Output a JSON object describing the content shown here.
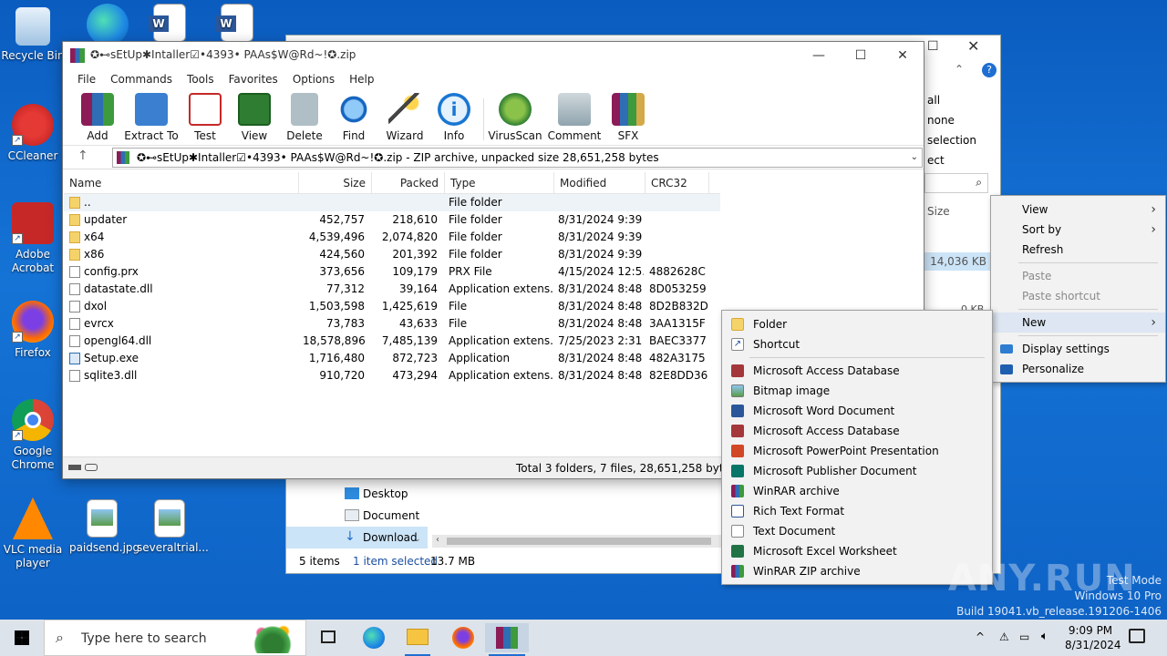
{
  "desktop": {
    "icons": [
      {
        "label": "Recycle Bin"
      },
      {
        "label": "CCleaner"
      },
      {
        "label": "Adobe Acrobat"
      },
      {
        "label": "Firefox"
      },
      {
        "label": "Google Chrome"
      },
      {
        "label": "VLC media player"
      },
      {
        "label": "paidsend.jpg"
      },
      {
        "label": "severaltrial..."
      }
    ]
  },
  "explorer": {
    "partial_text": [
      "all",
      "none",
      "selection",
      "ect"
    ],
    "size_col": "Size",
    "size_value": "14,036 KB",
    "kb_partial": "0 KB",
    "nav": [
      "Desktop",
      "Document",
      "Download"
    ],
    "status_items": "5 items",
    "status_selected": "1 item selected",
    "status_size": "13.7 MB"
  },
  "winrar": {
    "title": "✪⊷sEtUp✱Intaller☑•4393• PAAs$W@Rd~!✪.zip",
    "menu": [
      "File",
      "Commands",
      "Tools",
      "Favorites",
      "Options",
      "Help"
    ],
    "tools": [
      "Add",
      "Extract To",
      "Test",
      "View",
      "Delete",
      "Find",
      "Wizard",
      "Info",
      "VirusScan",
      "Comment",
      "SFX"
    ],
    "address": "✪⊷sEtUp✱Intaller☑•4393• PAAs$W@Rd~!✪.zip - ZIP archive, unpacked size 28,651,258 bytes",
    "columns": [
      "Name",
      "Size",
      "Packed",
      "Type",
      "Modified",
      "CRC32"
    ],
    "rows": [
      {
        "name": "..",
        "size": "",
        "packed": "",
        "type": "File folder",
        "modified": "",
        "crc": "",
        "kind": "folder"
      },
      {
        "name": "updater",
        "size": "452,757",
        "packed": "218,610",
        "type": "File folder",
        "modified": "8/31/2024 9:39 ...",
        "crc": "",
        "kind": "folder"
      },
      {
        "name": "x64",
        "size": "4,539,496",
        "packed": "2,074,820",
        "type": "File folder",
        "modified": "8/31/2024 9:39 ...",
        "crc": "",
        "kind": "folder"
      },
      {
        "name": "x86",
        "size": "424,560",
        "packed": "201,392",
        "type": "File folder",
        "modified": "8/31/2024 9:39 ...",
        "crc": "",
        "kind": "folder"
      },
      {
        "name": "config.prx",
        "size": "373,656",
        "packed": "109,179",
        "type": "PRX File",
        "modified": "4/15/2024 12:5...",
        "crc": "4882628C",
        "kind": "file"
      },
      {
        "name": "datastate.dll",
        "size": "77,312",
        "packed": "39,164",
        "type": "Application extens...",
        "modified": "8/31/2024 8:48 ...",
        "crc": "8D053259",
        "kind": "file"
      },
      {
        "name": "dxol",
        "size": "1,503,598",
        "packed": "1,425,619",
        "type": "File",
        "modified": "8/31/2024 8:48 ...",
        "crc": "8D2B832D",
        "kind": "file"
      },
      {
        "name": "evrcx",
        "size": "73,783",
        "packed": "43,633",
        "type": "File",
        "modified": "8/31/2024 8:48 ...",
        "crc": "3AA1315F",
        "kind": "file"
      },
      {
        "name": "opengl64.dll",
        "size": "18,578,896",
        "packed": "7,485,139",
        "type": "Application extens...",
        "modified": "7/25/2023 2:31 ...",
        "crc": "BAEC3377",
        "kind": "file"
      },
      {
        "name": "Setup.exe",
        "size": "1,716,480",
        "packed": "872,723",
        "type": "Application",
        "modified": "8/31/2024 8:48 ...",
        "crc": "482A3175",
        "kind": "exe"
      },
      {
        "name": "sqlite3.dll",
        "size": "910,720",
        "packed": "473,294",
        "type": "Application extens...",
        "modified": "8/31/2024 8:48 ...",
        "crc": "82E8DD36",
        "kind": "file"
      }
    ],
    "status": "Total 3 folders, 7 files, 28,651,258 bytes"
  },
  "context_menu": {
    "items": [
      {
        "label": "View",
        "sub": true
      },
      {
        "label": "Sort by",
        "sub": true
      },
      {
        "label": "Refresh"
      },
      {
        "label": "Paste",
        "disabled": true
      },
      {
        "label": "Paste shortcut",
        "disabled": true
      },
      {
        "label": "New",
        "sub": true
      },
      {
        "label": "Display settings"
      },
      {
        "label": "Personalize"
      }
    ]
  },
  "new_menu": {
    "items": [
      {
        "label": "Folder"
      },
      {
        "label": "Shortcut"
      },
      {
        "label": "Microsoft Access Database"
      },
      {
        "label": "Bitmap image"
      },
      {
        "label": "Microsoft Word Document"
      },
      {
        "label": "Microsoft Access Database"
      },
      {
        "label": "Microsoft PowerPoint Presentation"
      },
      {
        "label": "Microsoft Publisher Document"
      },
      {
        "label": "WinRAR archive"
      },
      {
        "label": "Rich Text Format"
      },
      {
        "label": "Text Document"
      },
      {
        "label": "Microsoft Excel Worksheet"
      },
      {
        "label": "WinRAR ZIP archive"
      }
    ]
  },
  "taskbar": {
    "search_placeholder": "Type here to search",
    "time": "9:09 PM",
    "date": "8/31/2024"
  },
  "watermark": {
    "brand": "ANY.RUN",
    "line1": "Test Mode",
    "line2": "Windows 10 Pro",
    "line3": "Build 19041.vb_release.191206-1406"
  },
  "colors": {
    "desktop_blue": "#1573d6",
    "selection": "#dde6f2",
    "taskbar": "#dde3ea"
  }
}
